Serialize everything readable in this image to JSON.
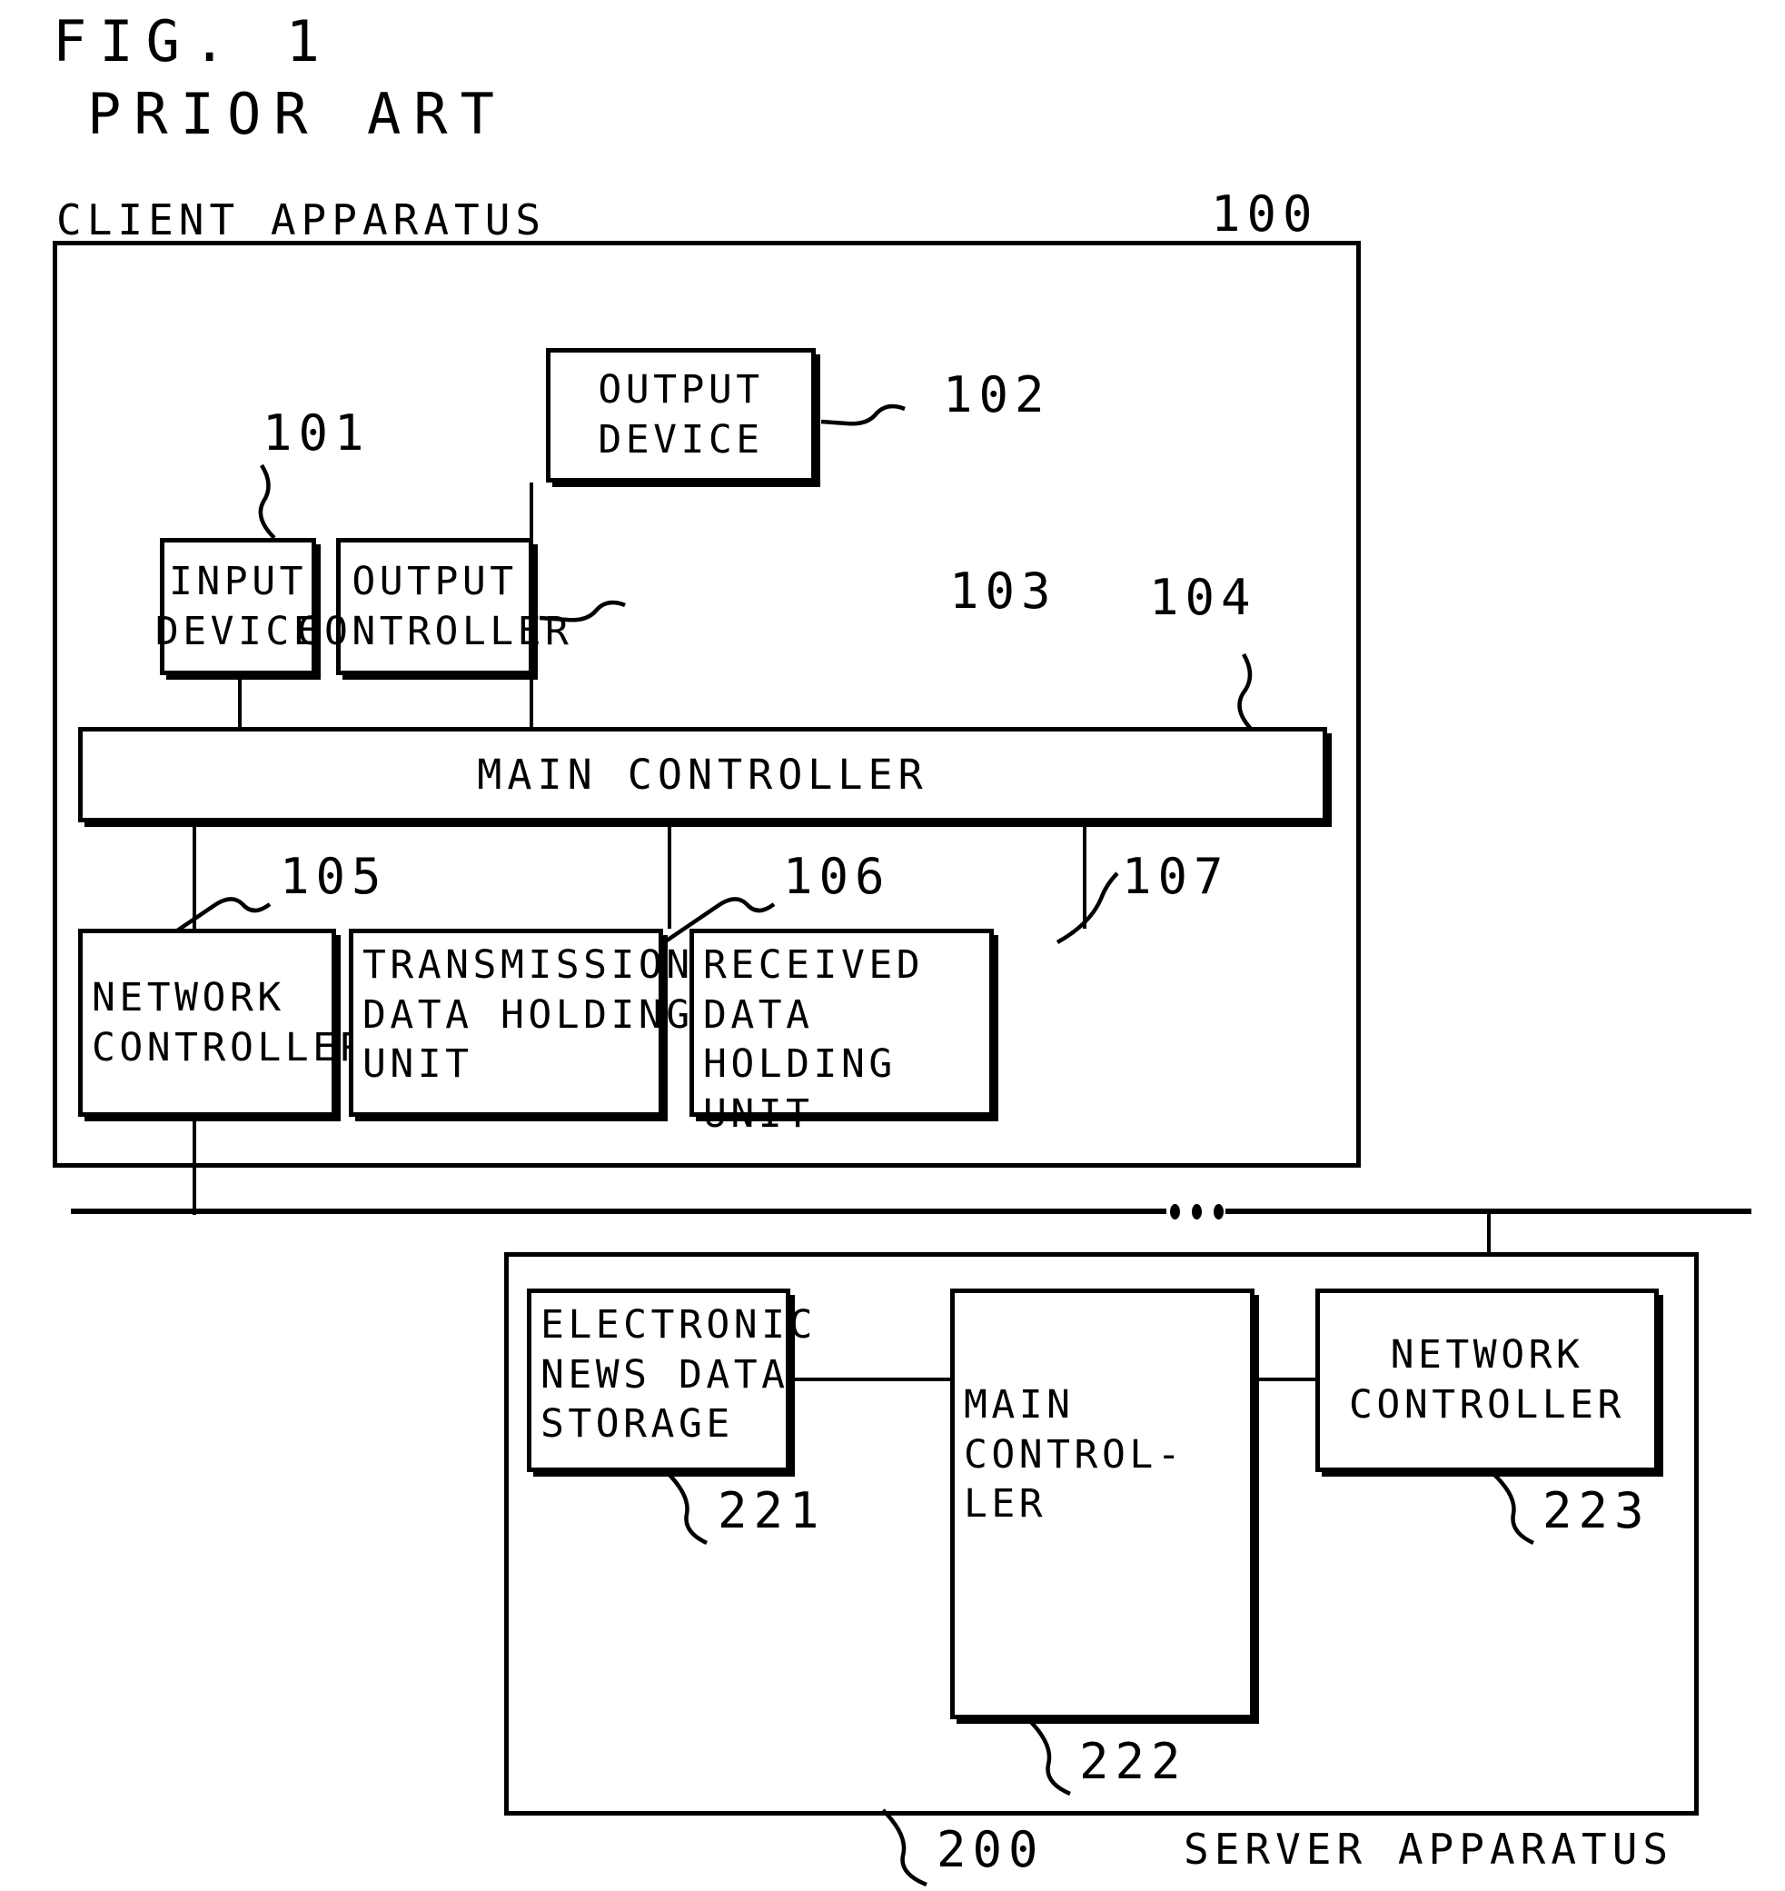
{
  "figure": {
    "title": "FIG. 1",
    "subtitle": "PRIOR ART"
  },
  "client": {
    "label": "CLIENT APPARATUS",
    "ref": "100",
    "blocks": [
      {
        "id": "output_device",
        "label": "OUTPUT\nDEVICE",
        "ref": "102"
      },
      {
        "id": "input_device",
        "label": "INPUT\nDEVICE",
        "ref": "101"
      },
      {
        "id": "output_controller",
        "label": "OUTPUT\nCONTROLLER",
        "ref": "103"
      },
      {
        "id": "main_controller",
        "label": "MAIN CONTROLLER",
        "ref": "104"
      },
      {
        "id": "network_controller",
        "label": "NETWORK\nCONTROLLER",
        "ref": "105"
      },
      {
        "id": "tx_holding",
        "label": "TRANSMISSION\nDATA HOLDING\nUNIT",
        "ref": "106"
      },
      {
        "id": "rx_holding",
        "label": "RECEIVED\nDATA HOLDING\nUNIT",
        "ref": "107"
      }
    ]
  },
  "network": {
    "ellipsis": "..."
  },
  "server": {
    "label": "SERVER APPARATUS",
    "ref": "200",
    "blocks": [
      {
        "id": "news_storage",
        "label": "ELECTRONIC\nNEWS DATA\nSTORAGE",
        "ref": "221"
      },
      {
        "id": "main_controller",
        "label": "MAIN\nCONTROL-\nLER",
        "ref": "222"
      },
      {
        "id": "network_controller",
        "label": "NETWORK\nCONTROLLER",
        "ref": "223"
      }
    ]
  }
}
